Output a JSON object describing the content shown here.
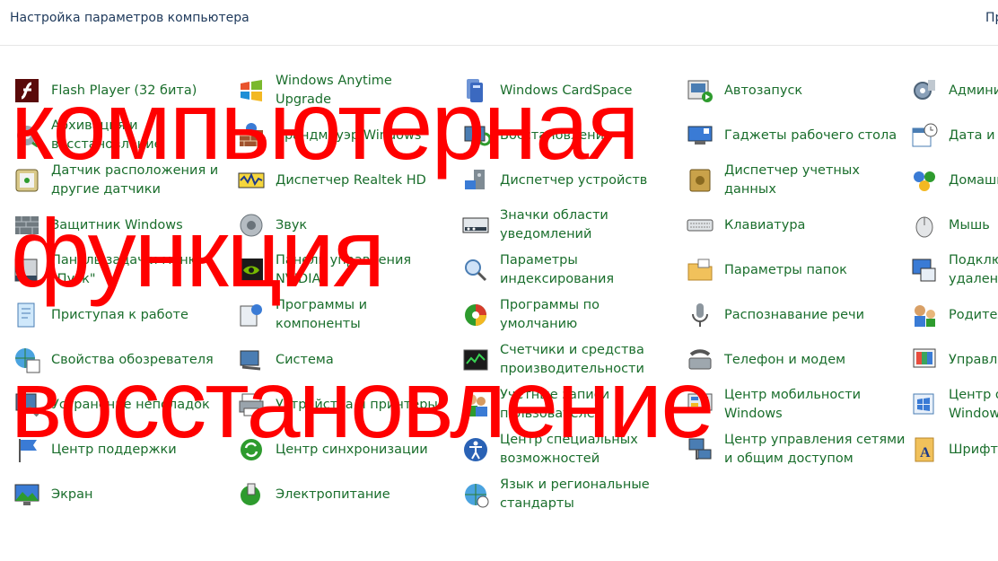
{
  "header": {
    "title": "Настройка параметров компьютера",
    "right_text": "Пр"
  },
  "items": [
    {
      "id": "flash-player",
      "lines": [
        "Flash Player (32 бита)"
      ],
      "icon": "flash-icon"
    },
    {
      "id": "windows-anytime-upgrade",
      "lines": [
        "Windows Anytime",
        "Upgrade"
      ],
      "icon": "windows-logo-icon"
    },
    {
      "id": "windows-cardspace",
      "lines": [
        "Windows CardSpace"
      ],
      "icon": "cardspace-icon"
    },
    {
      "id": "autorun",
      "lines": [
        "Автозапуск"
      ],
      "icon": "autoplay-icon"
    },
    {
      "id": "administration",
      "lines": [
        "Админи"
      ],
      "icon": "admin-tools-icon"
    },
    {
      "id": "backup-restore",
      "lines": [
        "Архивация и",
        "восстановление"
      ],
      "icon": "backup-icon"
    },
    {
      "id": "windows-firewall",
      "lines": [
        "Брандмауэр Windows"
      ],
      "icon": "firewall-icon"
    },
    {
      "id": "recovery",
      "lines": [
        "Восстановление"
      ],
      "icon": "recovery-icon"
    },
    {
      "id": "desktop-gadgets",
      "lines": [
        "Гаджеты рабочего стола"
      ],
      "icon": "gadgets-icon"
    },
    {
      "id": "date-time",
      "lines": [
        "Дата и в"
      ],
      "icon": "calendar-clock-icon"
    },
    {
      "id": "location-sensors",
      "lines": [
        "Датчик расположения и",
        "другие датчики"
      ],
      "icon": "sensor-icon"
    },
    {
      "id": "realtek-hd-manager",
      "lines": [
        "Диспетчер Realtek HD"
      ],
      "icon": "realtek-audio-icon"
    },
    {
      "id": "device-manager",
      "lines": [
        "Диспетчер устройств"
      ],
      "icon": "device-manager-icon"
    },
    {
      "id": "credential-manager",
      "lines": [
        "Диспетчер учетных",
        "данных"
      ],
      "icon": "credential-vault-icon"
    },
    {
      "id": "homegroup",
      "lines": [
        "Домашн"
      ],
      "icon": "homegroup-icon"
    },
    {
      "id": "windows-defender",
      "lines": [
        "Защитник Windows"
      ],
      "icon": "defender-wall-icon"
    },
    {
      "id": "sound",
      "lines": [
        "Звук"
      ],
      "icon": "speaker-icon"
    },
    {
      "id": "notification-icons",
      "lines": [
        "Значки области",
        "уведомлений"
      ],
      "icon": "notification-area-icon"
    },
    {
      "id": "keyboard",
      "lines": [
        "Клавиатура"
      ],
      "icon": "keyboard-icon"
    },
    {
      "id": "mouse",
      "lines": [
        "Мышь"
      ],
      "icon": "mouse-icon"
    },
    {
      "id": "taskbar-start-menu",
      "lines": [
        "Панель задач и меню",
        "\"Пуск\""
      ],
      "icon": "taskbar-icon"
    },
    {
      "id": "nvidia-control-panel",
      "lines": [
        "Панель управления",
        "NVIDIA"
      ],
      "icon": "nvidia-icon"
    },
    {
      "id": "indexing-options",
      "lines": [
        "Параметры",
        "индексирования"
      ],
      "icon": "indexing-icon"
    },
    {
      "id": "folder-options",
      "lines": [
        "Параметры папок"
      ],
      "icon": "folder-options-icon"
    },
    {
      "id": "remote-connection",
      "lines": [
        "Подклю",
        "удаленн"
      ],
      "icon": "remote-desktop-icon"
    },
    {
      "id": "getting-started",
      "lines": [
        "Приступая к работе"
      ],
      "icon": "getting-started-icon"
    },
    {
      "id": "programs-features",
      "lines": [
        "Программы и",
        "компоненты"
      ],
      "icon": "programs-icon"
    },
    {
      "id": "default-programs",
      "lines": [
        "Программы по",
        "умолчанию"
      ],
      "icon": "default-programs-icon"
    },
    {
      "id": "speech-recognition",
      "lines": [
        "Распознавание речи"
      ],
      "icon": "microphone-icon"
    },
    {
      "id": "parental-controls",
      "lines": [
        "Родител"
      ],
      "icon": "parental-controls-icon"
    },
    {
      "id": "internet-options",
      "lines": [
        "Свойства обозревателя"
      ],
      "icon": "internet-options-icon"
    },
    {
      "id": "system",
      "lines": [
        "Система"
      ],
      "icon": "system-computer-icon"
    },
    {
      "id": "performance",
      "lines": [
        "Счетчики и средства",
        "производительности"
      ],
      "icon": "performance-meter-icon"
    },
    {
      "id": "phone-modem",
      "lines": [
        "Телефон и модем"
      ],
      "icon": "phone-modem-icon"
    },
    {
      "id": "manage",
      "lines": [
        "Управле"
      ],
      "icon": "color-management-icon"
    },
    {
      "id": "troubleshooting",
      "lines": [
        "Устранение неполадок"
      ],
      "icon": "troubleshooting-icon"
    },
    {
      "id": "devices-printers",
      "lines": [
        "Устройства и принтеры"
      ],
      "icon": "printer-icon"
    },
    {
      "id": "user-accounts",
      "lines": [
        "Учетные записи",
        "пользователей"
      ],
      "icon": "user-accounts-icon"
    },
    {
      "id": "mobility-center",
      "lines": [
        "Центр мобильности",
        "Windows"
      ],
      "icon": "mobility-center-icon"
    },
    {
      "id": "windows-center",
      "lines": [
        "Центр о",
        "Window"
      ],
      "icon": "windows-update-icon"
    },
    {
      "id": "action-center",
      "lines": [
        "Центр поддержки"
      ],
      "icon": "action-center-flag-icon"
    },
    {
      "id": "sync-center",
      "lines": [
        "Центр синхронизации"
      ],
      "icon": "sync-icon"
    },
    {
      "id": "ease-of-access",
      "lines": [
        "Центр специальных",
        "возможностей"
      ],
      "icon": "ease-of-access-icon"
    },
    {
      "id": "network-sharing",
      "lines": [
        "Центр управления сетями",
        "и общим доступом"
      ],
      "icon": "network-icon"
    },
    {
      "id": "fonts",
      "lines": [
        "Шрифты"
      ],
      "icon": "fonts-icon"
    },
    {
      "id": "display",
      "lines": [
        "Экран"
      ],
      "icon": "display-icon"
    },
    {
      "id": "power-options",
      "lines": [
        "Электропитание"
      ],
      "icon": "power-battery-icon"
    },
    {
      "id": "region-language",
      "lines": [
        "Язык и региональные",
        "стандарты"
      ],
      "icon": "globe-clock-icon"
    }
  ],
  "overlay": {
    "words": [
      "компьютерная",
      "функция",
      "восстановление"
    ],
    "color": "#ff0000"
  },
  "colors": {
    "link": "#1a6e2c",
    "header_text": "#1e395b"
  }
}
